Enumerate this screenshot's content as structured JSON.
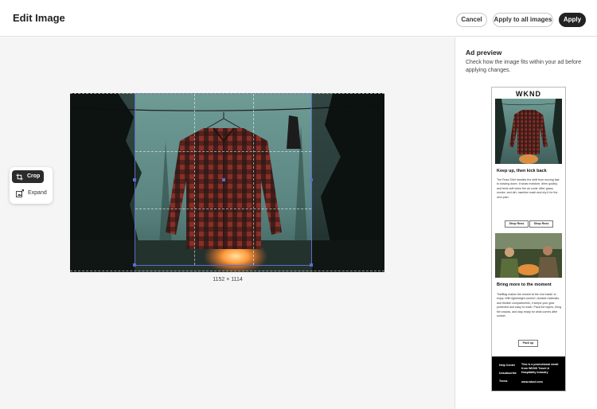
{
  "header": {
    "title": "Edit Image",
    "cancel_label": "Cancel",
    "apply_all_label": "Apply to all images",
    "apply_label": "Apply"
  },
  "tools": {
    "items": [
      {
        "label": "Crop",
        "icon": "crop-icon",
        "selected": true
      },
      {
        "label": "Expand",
        "icon": "expand-icon",
        "selected": false
      }
    ]
  },
  "canvas": {
    "dimensions": "1152 × 1114"
  },
  "preview": {
    "title": "Ad preview",
    "description": "Check how the image fits within your ad before applying changes.",
    "ad": {
      "logo": "WKND",
      "heading_1": "Keep up, then kick back",
      "body_1": "The Ross Shirt handles the shift from moving fast to slowing down. It wicks moisture, dries quickly, and feels soft when the air cools. After grass, smoke, and dirt, machine wash and dry it for the next plan.",
      "button_1": "Shop Ross",
      "button_2": "Shop Ross",
      "heading_2": "Bring more to the moment",
      "body_2": "TrailBag makes the reward at the end easier to enjoy. With lightweight comfort, durable materials, and flexible compartments, it keeps your gear protected and easy to reach. Pack the layers, bring the snacks, and stay ready for what comes after sunset.",
      "button_3": "Pack up",
      "footer": {
        "link_1": "Help Center",
        "link_2": "Unsubscribe",
        "link_3": "Terms",
        "text_1": "This is a promotional email from WKND Travel & Hospitality Industry",
        "text_2": "www.wknd.com"
      }
    }
  },
  "colors": {
    "accent": "#222222",
    "crop_border": "#5a6ec8"
  }
}
